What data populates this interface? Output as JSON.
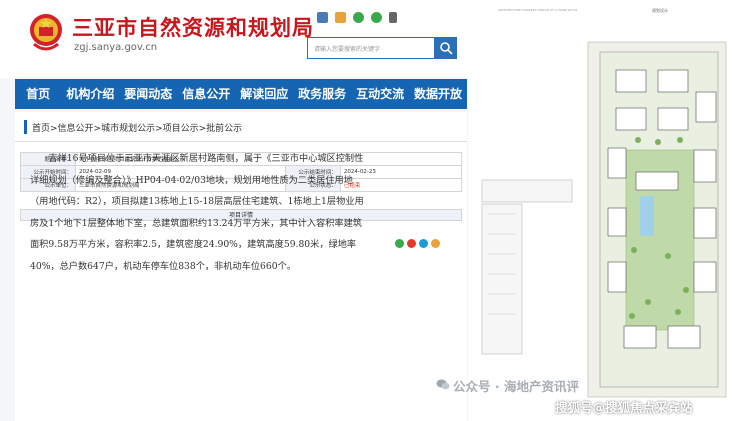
{
  "header": {
    "site_title": "三亚市自然资源和规划局",
    "domain": "zgj.sanya.gov.cn",
    "search_placeholder": "请输入您要搜索的关键字"
  },
  "nav": [
    "首页",
    "机构介绍",
    "要闻动态",
    "信息公开",
    "解读回应",
    "政务服务",
    "互动交流",
    "数据开放"
  ],
  "breadcrumb": "首页>信息公开>城市规划公示>项目公示>批前公示",
  "info": {
    "title_label": "题目名称：",
    "title_value": "关于吉祥16号项目建筑设计方案的批前公示",
    "start_label": "公示开始时间：",
    "start_value": "2024-02-09",
    "end_label": "公示结束时间：",
    "end_value": "2024-02-23",
    "unit_label": "公示单位：",
    "unit_value": "三亚市自然资源和规划局",
    "status_label": "公示状态：",
    "status_value": "已结束",
    "detail_title": "项目详情"
  },
  "article": "吉祥16号项目位于三亚市天涯区新居村路南侧，属于《三亚市中心城区控制性详细规划（修编及整合）》HP04-04-02/03地块，规划用地性质为二类居住用地（用地代码：R2），项目拟建13栋地上15-18层高层住宅建筑、1栋地上1层物业用房及1个地下1层整体地下室，总建筑面积约13.24万平方米，其中计入容积率建筑面积9.58万平方米，容积率2.5，建筑密度24.90%，建筑高度59.80米，绿地率40%，总户数647户，机动车停车位838个，非机动车位660个。",
  "plan": {
    "header_left": "ARCHITECTURE CONCEPT DESIGN OF JI XIANG NO.16",
    "header_right": "规划设计"
  },
  "watermarks": {
    "top": "公众号 · 海地产资讯评",
    "bottom": "搜狐号@搜狐焦点采宾站"
  },
  "colors": {
    "brand_red": "#c8161d",
    "nav_blue": "#1565b3"
  }
}
